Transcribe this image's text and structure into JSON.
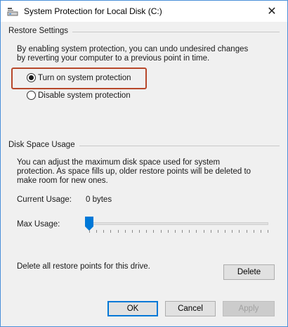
{
  "window": {
    "title": "System Protection for Local Disk (C:)",
    "close_glyph": "✕",
    "icon": "drive-icon"
  },
  "restore_settings": {
    "group_label": "Restore Settings",
    "description": "By enabling system protection, you can undo undesired changes by reverting your computer to a previous point in time.",
    "options": [
      {
        "label": "Turn on system protection",
        "selected": true
      },
      {
        "label": "Disable system protection",
        "selected": false
      }
    ],
    "highlight_color": "#b7472a"
  },
  "disk_space": {
    "group_label": "Disk Space Usage",
    "description": "You can adjust the maximum disk space used for system protection. As space fills up, older restore points will be deleted to make room for new ones.",
    "current_usage_label": "Current Usage:",
    "current_usage_value": "0 bytes",
    "max_usage_label": "Max Usage:",
    "max_usage_fraction": 0,
    "delete_text": "Delete all restore points for this drive.",
    "delete_button": "Delete"
  },
  "footer": {
    "ok": "OK",
    "cancel": "Cancel",
    "apply": "Apply"
  },
  "colors": {
    "accent": "#0078d7",
    "window_border": "#4a90d9",
    "thumb": "#0078d7"
  }
}
